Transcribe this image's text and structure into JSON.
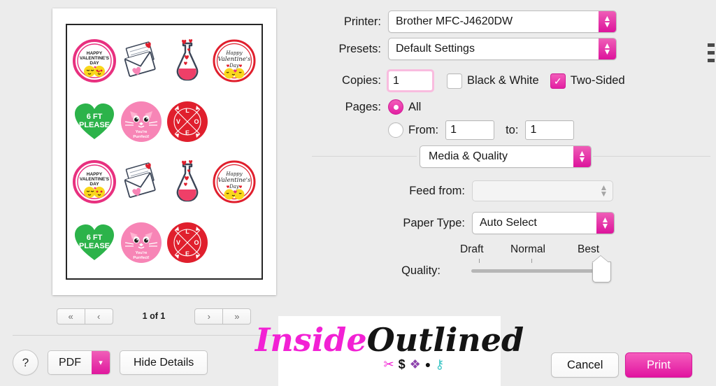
{
  "dialog": {
    "printer": {
      "label": "Printer:",
      "value": "Brother MFC-J4620DW"
    },
    "presets": {
      "label": "Presets:",
      "value": "Default Settings"
    },
    "copies": {
      "label": "Copies:",
      "value": "1",
      "black_white": {
        "label": "Black & White",
        "checked": false
      },
      "two_sided": {
        "label": "Two-Sided",
        "checked": true,
        "check_glyph": "✓"
      }
    },
    "pages": {
      "label": "Pages:",
      "all_label": "All",
      "all_selected": true,
      "from_label": "From:",
      "from_value": "1",
      "to_label": "to:",
      "to_value": "1"
    },
    "section": {
      "value": "Media & Quality"
    },
    "feed_from": {
      "label": "Feed from:",
      "value": "",
      "disabled": true
    },
    "paper_type": {
      "label": "Paper Type:",
      "value": "Auto Select"
    },
    "quality": {
      "label": "Quality:",
      "ticks": [
        "Draft",
        "Normal",
        "Best"
      ],
      "selected": "Best"
    }
  },
  "preview": {
    "nav": {
      "first": "«",
      "prev": "‹",
      "next": "›",
      "last": "»",
      "page_label": "1 of 1"
    },
    "stickers": [
      {
        "type": "happy-valentines-emoji",
        "line1": "HAPPY",
        "line2": "VALENTINE'S",
        "line3": "DAY",
        "ring": "#e8307f"
      },
      {
        "type": "love-letter-envelope",
        "line1": "",
        "line2": "",
        "line3": "",
        "ring": "#3b4557"
      },
      {
        "type": "love-potion-bottle",
        "line1": "",
        "line2": "",
        "line3": "",
        "ring": "#3b4557"
      },
      {
        "type": "happy-valentines-day-script",
        "line1": "Happy",
        "line2": "Valentine's",
        "line3": "Day",
        "ring": "#e01f2d"
      },
      {
        "type": "six-ft-please-heart",
        "line1": "6 FT",
        "line2": "PLEASE",
        "line3": "",
        "ring": "#2cb34a"
      },
      {
        "type": "youre-purrfect-cat",
        "line1": "You're",
        "line2": "Purrfect!",
        "line3": "",
        "ring": "#f785b6"
      },
      {
        "type": "love-arrows-circle",
        "line1": "L O V E",
        "line2": "",
        "line3": "",
        "ring": "#e01f2d"
      }
    ]
  },
  "buttons": {
    "help": "?",
    "pdf": "PDF",
    "hide_details": "Hide Details",
    "cancel": "Cancel",
    "print": "Print"
  },
  "watermark": {
    "word1": "Inside",
    "word2": "Outlined",
    "icons": [
      "scissors-icon",
      "dollar-icon",
      "puzzle-icon",
      "lightbulb-icon",
      "safety-pin-icon"
    ],
    "glyphs": [
      "✂",
      "$",
      "❖",
      "●",
      "⚷"
    ]
  },
  "colors": {
    "accent": "#e21fa2",
    "accent_light": "#f45ebb",
    "window_bg": "#ececec",
    "watermark_pink": "#f221d4"
  }
}
